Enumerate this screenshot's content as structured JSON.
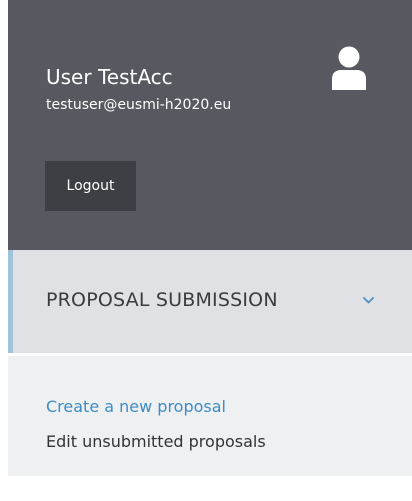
{
  "user": {
    "name": "User TestAcc",
    "email": "testuser@eusmi-h2020.eu",
    "logout_label": "Logout",
    "avatar_icon": "user-icon"
  },
  "section": {
    "title": "PROPOSAL SUBMISSION",
    "expanded": true,
    "toggle_icon": "chevron-down-icon",
    "accent_color": "#9dc5dc"
  },
  "submenu": {
    "items": [
      {
        "label": "Create a new proposal",
        "active": true,
        "color": "#3d8cc3"
      },
      {
        "label": "Edit unsubmitted proposals",
        "active": false,
        "color": "#333333"
      }
    ]
  },
  "colors": {
    "user_panel_bg": "#575860",
    "logout_bg": "#3e3f45",
    "section_bg": "#dfe1e4",
    "submenu_bg": "#eef0f2"
  }
}
